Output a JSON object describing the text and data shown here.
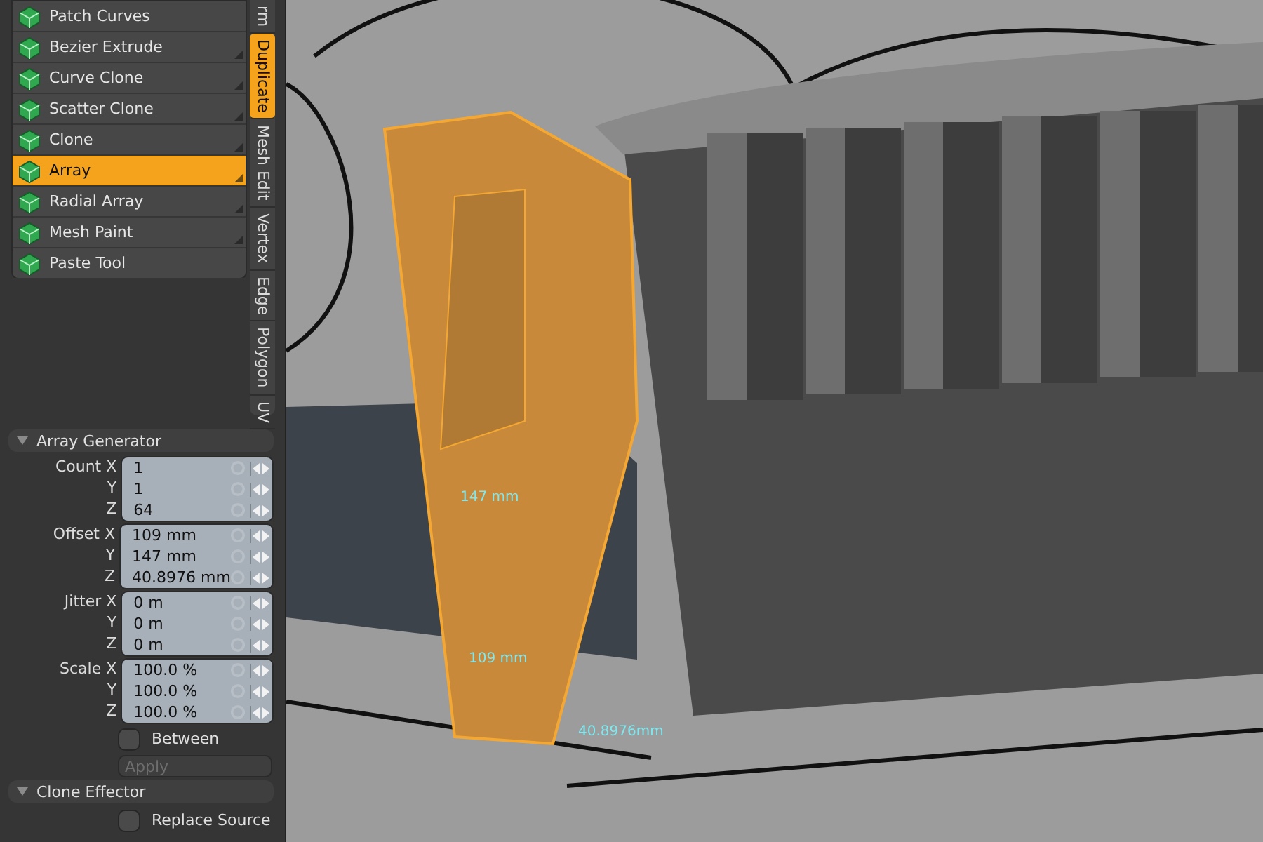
{
  "tools": [
    {
      "label": "Patch Curves",
      "selected": false,
      "submenu": false
    },
    {
      "label": "Bezier Extrude",
      "selected": false,
      "submenu": true
    },
    {
      "label": "Curve Clone",
      "selected": false,
      "submenu": true
    },
    {
      "label": "Scatter Clone",
      "selected": false,
      "submenu": true
    },
    {
      "label": "Clone",
      "selected": false,
      "submenu": true
    },
    {
      "label": "Array",
      "selected": true,
      "submenu": true
    },
    {
      "label": "Radial Array",
      "selected": false,
      "submenu": true
    },
    {
      "label": "Mesh Paint",
      "selected": false,
      "submenu": true
    },
    {
      "label": "Paste Tool",
      "selected": false,
      "submenu": false
    }
  ],
  "tabs": [
    {
      "label": "rm",
      "selected": false
    },
    {
      "label": "Duplicate",
      "selected": true
    },
    {
      "label": "Mesh Edit",
      "selected": false
    },
    {
      "label": "Vertex",
      "selected": false
    },
    {
      "label": "Edge",
      "selected": false
    },
    {
      "label": "Polygon",
      "selected": false
    },
    {
      "label": "UV",
      "selected": false
    }
  ],
  "sections": [
    {
      "title": "Array Generator",
      "expanded": true,
      "groups": [
        {
          "label": "Count",
          "rows": [
            {
              "axis": "X",
              "value": "1"
            },
            {
              "axis": "Y",
              "value": "1"
            },
            {
              "axis": "Z",
              "value": "64"
            }
          ]
        },
        {
          "label": "Offset",
          "rows": [
            {
              "axis": "X",
              "value": "109 mm"
            },
            {
              "axis": "Y",
              "value": "147 mm"
            },
            {
              "axis": "Z",
              "value": "40.8976 mm"
            }
          ]
        },
        {
          "label": "Jitter",
          "rows": [
            {
              "axis": "X",
              "value": "0 m"
            },
            {
              "axis": "Y",
              "value": "0 m"
            },
            {
              "axis": "Z",
              "value": "0 m"
            }
          ]
        },
        {
          "label": "Scale",
          "rows": [
            {
              "axis": "X",
              "value": "100.0 %"
            },
            {
              "axis": "Y",
              "value": "100.0 %"
            },
            {
              "axis": "Z",
              "value": "100.0 %"
            }
          ]
        }
      ],
      "checkboxes": [
        {
          "label": "Between",
          "checked": false
        }
      ],
      "button": {
        "label": "Apply",
        "disabled": true
      }
    },
    {
      "title": "Clone Effector",
      "expanded": true,
      "checkboxes": [
        {
          "label": "Replace Source",
          "checked": false
        }
      ]
    }
  ],
  "viewport": {
    "dimension_labels": [
      "147 mm",
      "109 mm",
      "40.8976mm"
    ]
  }
}
